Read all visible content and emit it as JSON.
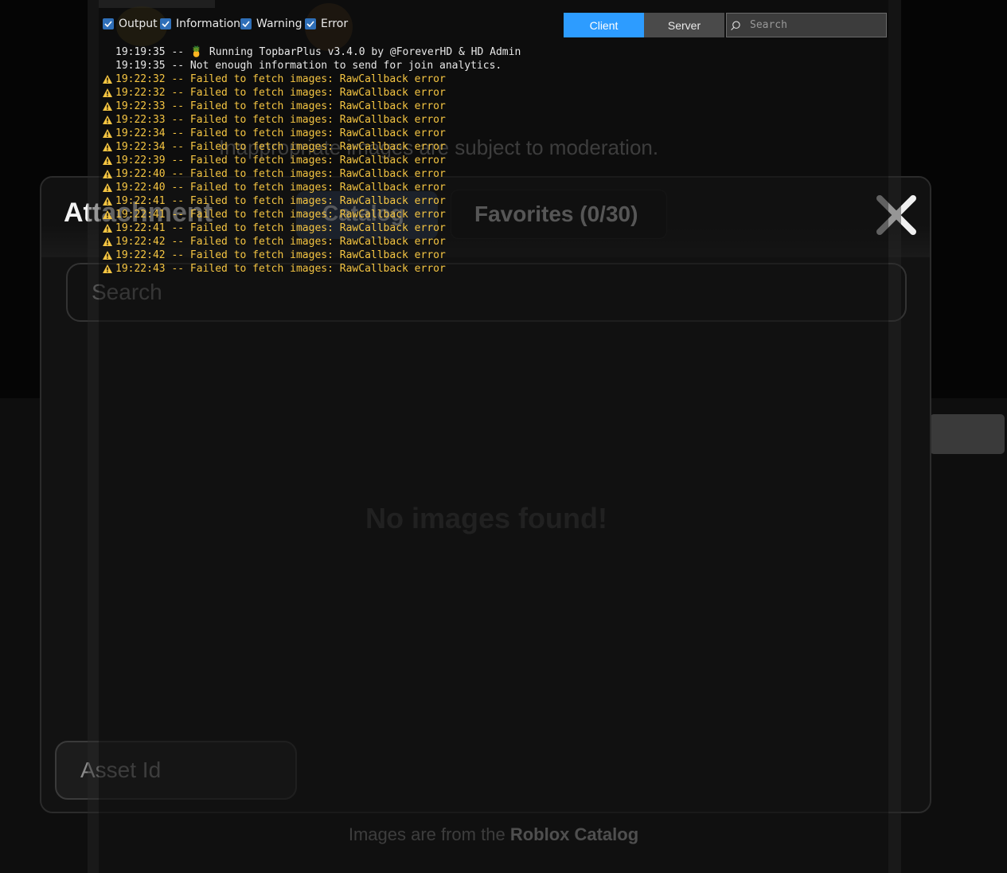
{
  "modal": {
    "title": "Attachment",
    "tabs": [
      {
        "label": "Catalog",
        "active": true
      },
      {
        "label": "Favorites (0/30)",
        "active": false
      }
    ],
    "search_placeholder": "Search",
    "empty_message": "No images found!",
    "asset_id_placeholder": "Asset Id",
    "footer_prefix": "Images are from the ",
    "footer_link": "Roblox Catalog",
    "moderation_note": "Inappropriate images are subject to moderation."
  },
  "console": {
    "filters": [
      {
        "label": "Output",
        "checked": true
      },
      {
        "label": "Information",
        "checked": true
      },
      {
        "label": "Warning",
        "checked": true
      },
      {
        "label": "Error",
        "checked": true
      }
    ],
    "client_label": "Client",
    "server_label": "Server",
    "search_placeholder": "Search",
    "accent_color": "#2d9cff",
    "warning_color": "#f5c542",
    "logs": [
      {
        "type": "output",
        "text": "19:19:35 -- 🍍 Running TopbarPlus v3.4.0 by @ForeverHD & HD Admin"
      },
      {
        "type": "output",
        "text": "19:19:35 -- Not enough information to send for join analytics."
      },
      {
        "type": "warning",
        "text": "19:22:32 -- Failed to fetch images: RawCallback error"
      },
      {
        "type": "warning",
        "text": "19:22:32 -- Failed to fetch images: RawCallback error"
      },
      {
        "type": "warning",
        "text": "19:22:33 -- Failed to fetch images: RawCallback error"
      },
      {
        "type": "warning",
        "text": "19:22:33 -- Failed to fetch images: RawCallback error"
      },
      {
        "type": "warning",
        "text": "19:22:34 -- Failed to fetch images: RawCallback error"
      },
      {
        "type": "warning",
        "text": "19:22:34 -- Failed to fetch images: RawCallback error"
      },
      {
        "type": "warning",
        "text": "19:22:39 -- Failed to fetch images: RawCallback error"
      },
      {
        "type": "warning",
        "text": "19:22:40 -- Failed to fetch images: RawCallback error"
      },
      {
        "type": "warning",
        "text": "19:22:40 -- Failed to fetch images: RawCallback error"
      },
      {
        "type": "warning",
        "text": "19:22:41 -- Failed to fetch images: RawCallback error"
      },
      {
        "type": "warning",
        "text": "19:22:41 -- Failed to fetch images: RawCallback error"
      },
      {
        "type": "warning",
        "text": "19:22:41 -- Failed to fetch images: RawCallback error"
      },
      {
        "type": "warning",
        "text": "19:22:42 -- Failed to fetch images: RawCallback error"
      },
      {
        "type": "warning",
        "text": "19:22:42 -- Failed to fetch images: RawCallback error"
      },
      {
        "type": "warning",
        "text": "19:22:43 -- Failed to fetch images: RawCallback error"
      }
    ]
  }
}
